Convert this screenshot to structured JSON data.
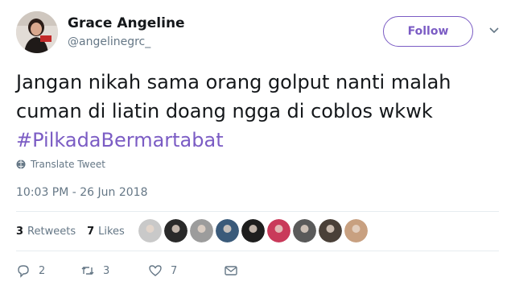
{
  "user": {
    "name": "Grace Angeline",
    "handle": "@angelinegrc_"
  },
  "follow_label": "Follow",
  "tweet": {
    "line1": "Jangan nikah sama orang golput nanti malah",
    "line2": "cuman di liatin doang ngga di coblos wkwk",
    "hashtag": "#PilkadaBermartabat"
  },
  "translate_label": "Translate Tweet",
  "timestamp": "10:03 PM - 26 Jun 2018",
  "stats": {
    "retweets_count": "3",
    "retweets_label": "Retweets",
    "likes_count": "7",
    "likes_label": "Likes"
  },
  "liker_avatars": [
    "#c9c9c9",
    "#2a2a2a",
    "#9c9c9c",
    "#3a5a7a",
    "#1e1e1e",
    "#c93a5a",
    "#5a5a5a",
    "#4a4038",
    "#c8a080"
  ],
  "actions": {
    "reply_count": "2",
    "retweet_count": "3",
    "like_count": "7"
  },
  "colors": {
    "accent": "#7b5cc4",
    "secondary_text": "#657786",
    "divider": "#e6ecf0"
  },
  "icons": [
    "translate-globe-icon",
    "chevron-down-icon",
    "reply-icon",
    "retweet-icon",
    "like-icon",
    "message-icon"
  ]
}
